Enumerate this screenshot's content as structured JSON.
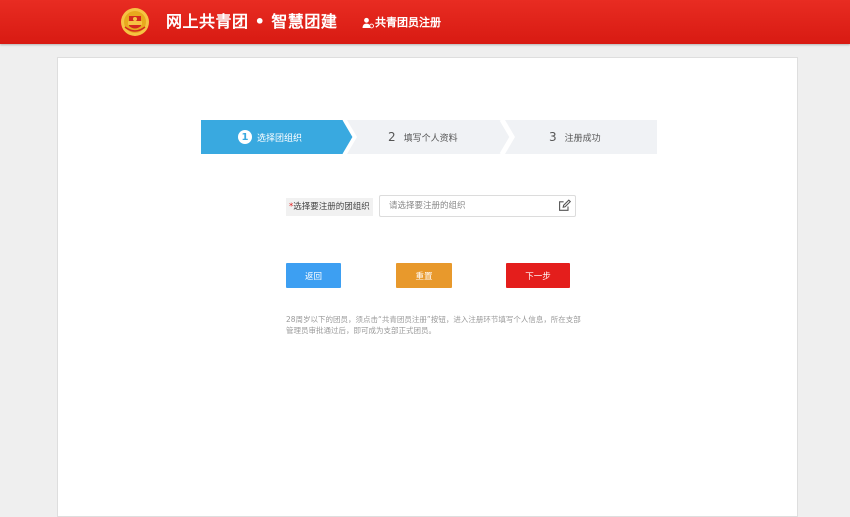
{
  "header": {
    "site_title": "网上共青团 • 智慧团建",
    "register_link": "共青团员注册",
    "brand_color": "#e02a20"
  },
  "steps": [
    {
      "number": "1",
      "label": "选择团组织",
      "active": true
    },
    {
      "number": "2",
      "label": "填写个人资料",
      "active": false
    },
    {
      "number": "3",
      "label": "注册成功",
      "active": false
    }
  ],
  "steps_colors": {
    "active": "#39a9e0",
    "inactive": "#f0f2f5"
  },
  "form": {
    "required_mark": "*",
    "org_label": "选择要注册的团组织",
    "org_placeholder": "请选择要注册的组织",
    "org_value": ""
  },
  "buttons": {
    "back": "返回",
    "reset": "重置",
    "next": "下一步"
  },
  "button_colors": {
    "back": "#3d9ff2",
    "reset": "#e8992c",
    "next": "#e41e1c"
  },
  "notice": "28周岁以下的团员，须点击“共青团员注册”按钮，进入注册环节填写个人信息，所在支部管理员审批通过后，即可成为支部正式团员。",
  "icons": {
    "logo": "youth-league-emblem-icon",
    "register": "user-add-icon",
    "edit": "edit-icon"
  }
}
